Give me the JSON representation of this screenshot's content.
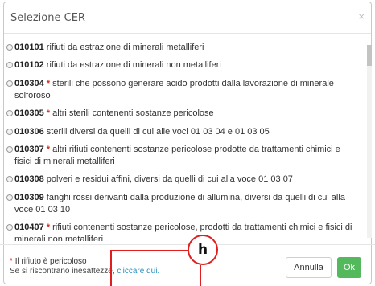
{
  "dialog": {
    "title": "Selezione CER",
    "close_symbol": "×"
  },
  "items": [
    {
      "code": "010101",
      "hazardous": false,
      "text": "rifiuti da estrazione di minerali metalliferi"
    },
    {
      "code": "010102",
      "hazardous": false,
      "text": "rifiuti da estrazione di minerali non metalliferi"
    },
    {
      "code": "010304",
      "hazardous": true,
      "text": "sterili che possono generare acido prodotti dalla lavorazione di minerale solforoso"
    },
    {
      "code": "010305",
      "hazardous": true,
      "text": "altri sterili contenenti sostanze pericolose"
    },
    {
      "code": "010306",
      "hazardous": false,
      "text": "sterili diversi da quelli di cui alle voci 01 03 04 e 01 03 05"
    },
    {
      "code": "010307",
      "hazardous": true,
      "text": "altri rifiuti contenenti sostanze pericolose prodotte da trattamenti chimici e fisici di minerali metalliferi"
    },
    {
      "code": "010308",
      "hazardous": false,
      "text": "polveri e residui affini, diversi da quelli di cui alla voce 01 03 07"
    },
    {
      "code": "010309",
      "hazardous": false,
      "text": "fanghi rossi derivanti dalla produzione di allumina, diversi da quelli di cui alla voce 01 03 10"
    },
    {
      "code": "010407",
      "hazardous": true,
      "text": "rifiuti contenenti sostanze pericolose, prodotti da trattamenti chimici e fisici di minerali non metalliferi"
    }
  ],
  "footer": {
    "legend_star": "*",
    "legend_text": "Il rifiuto è pericoloso",
    "hint_text": "Se si riscontrano inesattezze,",
    "hint_link": "cliccare qui."
  },
  "buttons": {
    "cancel": "Annulla",
    "ok": "Ok"
  },
  "annotation": {
    "label": "h"
  },
  "colors": {
    "hazard_star": "#e0261b",
    "ok_button": "#53b95c",
    "link": "#2a8fbd",
    "annotation": "#e01e1e"
  }
}
